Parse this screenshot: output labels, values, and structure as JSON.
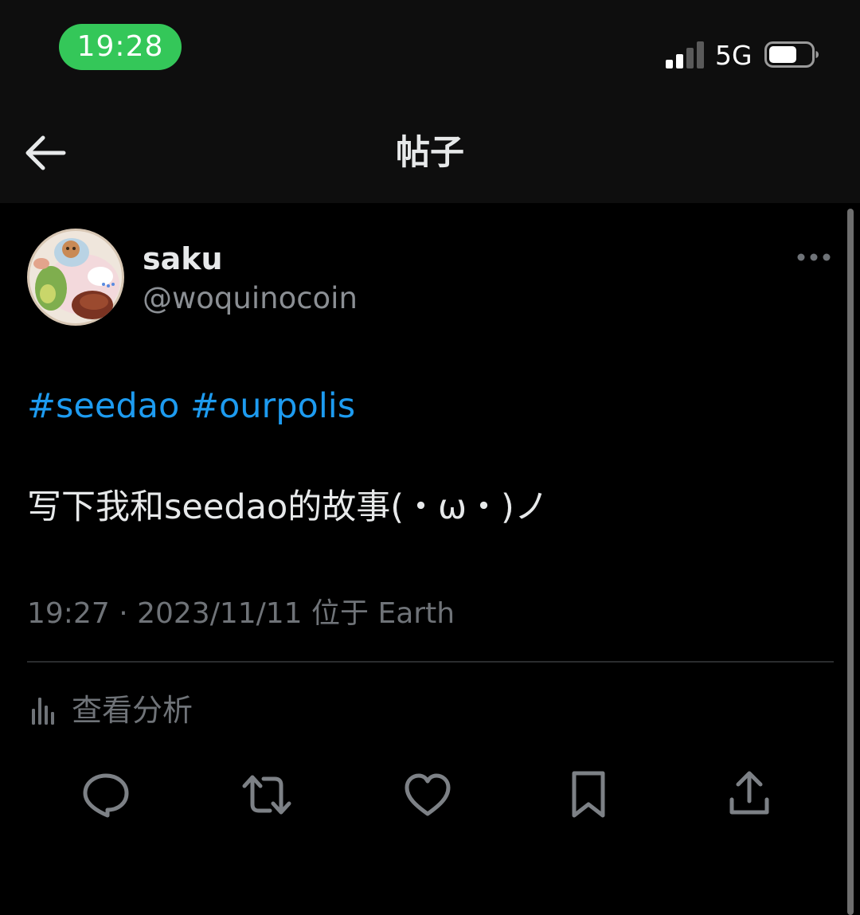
{
  "status_bar": {
    "time": "19:28",
    "network": "5G",
    "icons": [
      "signal-icon",
      "battery-icon"
    ],
    "time_pill_color": "#34c759"
  },
  "header": {
    "title": "帖子",
    "back_icon": "back-arrow-icon"
  },
  "post": {
    "author": {
      "display_name": "saku",
      "handle": "@woquinocoin"
    },
    "hashtags": [
      "#seedao",
      "#ourpolis"
    ],
    "text": "写下我和seedao的故事(・ω・)ノ",
    "time": "19:27",
    "separator": " · ",
    "date": "2023/11/11",
    "location": "位于 Earth",
    "analytics_label": "查看分析"
  },
  "actions": [
    "reply-icon",
    "repost-icon",
    "like-icon",
    "bookmark-icon",
    "share-icon"
  ],
  "colors": {
    "background": "#000000",
    "header_background": "#0e0e0e",
    "accent": "#1d9bf0",
    "primary_text": "#e7e9ea",
    "secondary_text": "#6f7378",
    "divider": "#2a2c2e"
  }
}
